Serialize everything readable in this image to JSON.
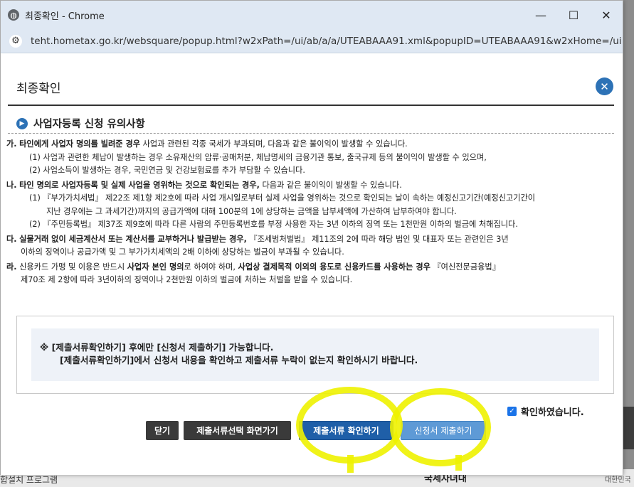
{
  "window": {
    "title": "최종확인 - Chrome",
    "url": "teht.hometax.go.kr/websquare/popup.html?w2xPath=/ui/ab/a/a/UTEABAAA91.xml&popupID=UTEABAAA91&w2xHome=/ui/ab..."
  },
  "background": {
    "bottom_left": "합설치 프로그램",
    "bottom_mid": "국세자녀대",
    "bottom_right": "대한민국"
  },
  "popup": {
    "title": "최종확인",
    "section_title": "사업자등록 신청 유의사항",
    "items": [
      {
        "lines": [
          {
            "marker": "가.",
            "bold": "타인에게 사업자 명의를 빌려준 경우",
            "text": " 사업과 관련된 각종 국세가 부과되며, 다음과 같은 불이익이 발생할 수 있습니다."
          },
          {
            "text": "(1) 사업과 관련한 체납이 발생하는 경우 소유재산의 압류·공매처분, 체납명세의 금융기관 통보, 출국규제 등의 불이익이 발생할 수 있으며,"
          },
          {
            "text": "(2) 사업소득이 발생하는 경우, 국민연금 및 건강보험료를 추가 부담할 수 있습니다."
          }
        ]
      },
      {
        "lines": [
          {
            "marker": "나.",
            "bold": "타인 명의로 사업자등록 및 실제 사업을 영위하는 것으로 확인되는 경우,",
            "text": " 다음과 같은 불이익이 발생할 수 있습니다."
          },
          {
            "text": "(1) 『부가가치세법』 제22조 제1항 제2호에 따라 사업 개시일로부터 실제 사업을 영위하는 것으로 확인되는 날이 속하는 예정신고기간(예정신고기간이"
          },
          {
            "text": "지난 경우에는 그 과세기간)까지의 공급가액에 대해 100분의 1에 상당하는 금액을 납부세액에 가산하여 납부하여야 합니다."
          },
          {
            "text": "(2) 『주민등록법』 제37조 제9호에 따라 다른 사람의 주민등록번호를 부정 사용한 자는 3년 이하의 징역 또는 1천만원 이하의 벌금에 처해집니다."
          }
        ]
      },
      {
        "lines": [
          {
            "marker": "다.",
            "bold": "실물거래 없이 세금계산서 또는 계산서를 교부하거나 발급받는 경우,",
            "text": " 『조세범처벌법』 제11조의 2에 따라 해당 법인 및 대표자 또는 관련인은 3년"
          },
          {
            "text": "이하의 징역이나 공급가액 및 그 부가가치세액의 2배 이하에 상당하는 벌금이 부과될 수 있습니다."
          }
        ]
      },
      {
        "lines": [
          {
            "marker": "라.",
            "pre": "신용카드 가맹 및 이용은 반드시 ",
            "bold": "사업자 본인 명의",
            "mid": "로 하여야 하며, ",
            "bold2": "사업상 결제목적 이외의 용도로 신용카드를 사용하는 경우",
            "text": " 『여신전문금융법』"
          },
          {
            "text": "제70조 제 2항에 따라 3년이하의 징역이나 2천만원 이하의 벌금에 처하는 처벌을 받을 수 있습니다."
          }
        ]
      }
    ],
    "box_line1": "※  [제출서류확인하기] 후에만 [신청서 제출하기] 가능합니다.",
    "box_line2": "[제출서류확인하기]에서 신청서 내용을 확인하고 제출서류 누락이 없는지 확인하시기 바랍니다.",
    "confirm_label": "확인하였습니다.",
    "confirm_checked": true,
    "buttons": {
      "close": "닫기",
      "go_select": "제출서류선택 화면가기",
      "check_docs": "제출서류 확인하기",
      "submit": "신청서 제출하기"
    }
  },
  "colors": {
    "accent": "#2d72b6",
    "highlight": "#eef200"
  }
}
